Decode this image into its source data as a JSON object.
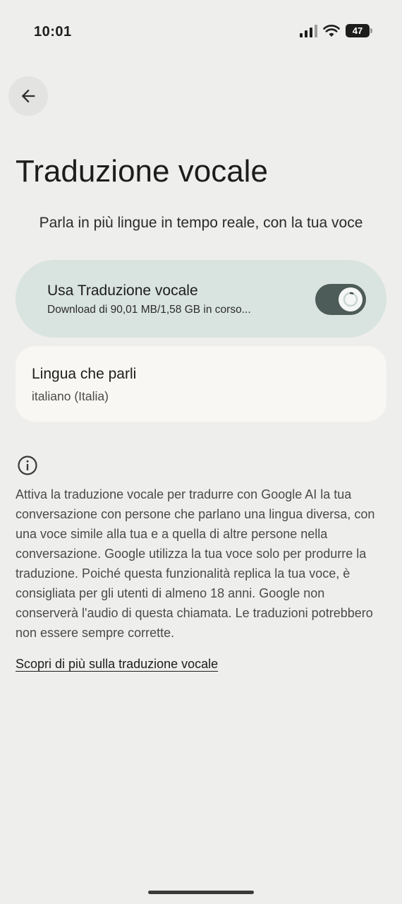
{
  "status_bar": {
    "time": "10:01",
    "battery": "47",
    "icons": [
      "signal-icon",
      "wifi-icon",
      "battery-icon"
    ]
  },
  "header": {
    "back_icon": "arrow-back-icon",
    "title": "Traduzione vocale",
    "subtitle": "Parla in più lingue in tempo reale, con la tua voce"
  },
  "toggle_card": {
    "title": "Usa Traduzione vocale",
    "status": "Download di 90,01 MB/1,58 GB in corso...",
    "enabled": true,
    "download_progress": 0.057
  },
  "language_card": {
    "title": "Lingua che parli",
    "value": "italiano (Italia)"
  },
  "info": {
    "icon": "info-icon",
    "text": "Attiva la traduzione vocale per tradurre con Google AI la tua conversazione con persone che parlano una lingua diversa, con una voce simile alla tua e a quella di altre persone nella conversazione. Google utilizza la tua voce solo per produrre la traduzione. Poiché questa funzionalità replica la tua voce, è consigliata per gli utenti di almeno 18 anni. Google non conserverà l'audio di questa chiamata. Le traduzioni potrebbero non essere sempre corrette.",
    "link": "Scopri di più sulla traduzione vocale"
  },
  "colors": {
    "background": "#eeeeec",
    "toggle_card": "#d9e4e0",
    "switch_track": "#4d5c58",
    "language_card": "#f8f7f4"
  }
}
